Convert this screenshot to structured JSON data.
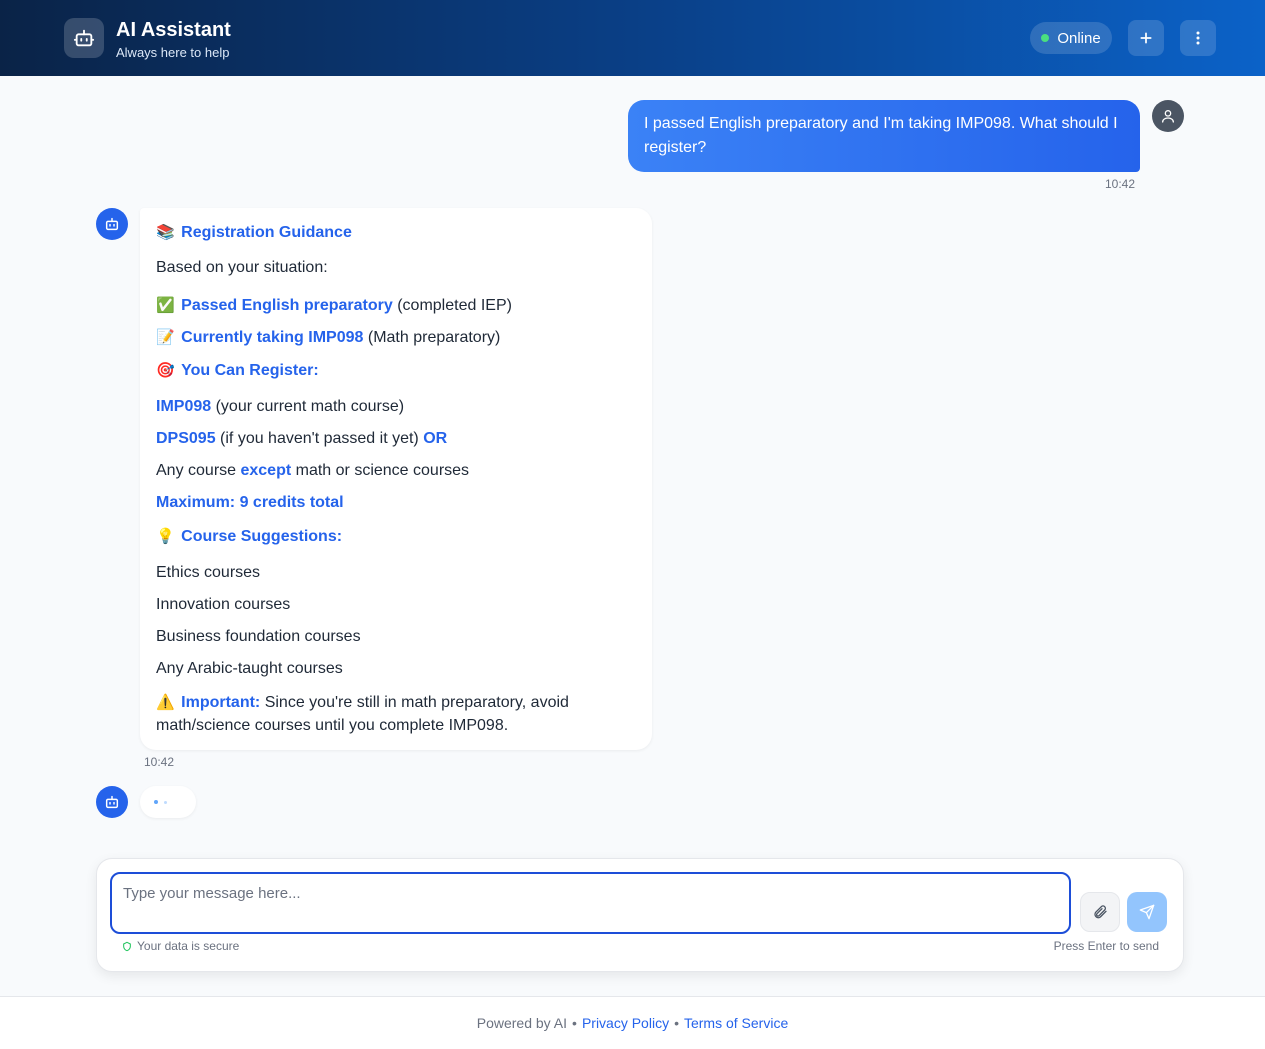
{
  "header": {
    "title": "AI Assistant",
    "subtitle": "Always here to help",
    "status": "Online",
    "new_chat_icon": "plus-icon",
    "menu_icon": "more-vertical-icon"
  },
  "conversation": {
    "user_message": {
      "text": "I passed English preparatory and I'm taking IMP098. What should I register?",
      "time": "10:42"
    },
    "bot_message": {
      "time": "10:42",
      "heading_emoji": "📚",
      "heading": "Registration Guidance",
      "intro": "Based on your situation:",
      "status_1_emoji": "✅",
      "status_1_bold": "Passed English preparatory",
      "status_1_rest": " (completed IEP)",
      "status_2_emoji": "📝",
      "status_2_bold": "Currently taking IMP098",
      "status_2_rest": " (Math preparatory)",
      "register_emoji": "🎯",
      "register_heading": "You Can Register:",
      "option_1_bold": "IMP098",
      "option_1_rest": " (your current math course)",
      "option_2_bold": "DPS095",
      "option_2_rest": " (if you haven't passed it yet) ",
      "option_2_or": "OR",
      "option_3_pre": "Any course ",
      "option_3_bold": "except",
      "option_3_rest": " math or science courses",
      "max_credits": "Maximum: 9 credits total",
      "suggest_emoji": "💡",
      "suggest_heading": "Course Suggestions:",
      "suggestions": [
        "Ethics courses",
        "Innovation courses",
        "Business foundation courses",
        "Any Arabic-taught courses"
      ],
      "warn_emoji": "⚠️",
      "warn_bold": "Important:",
      "warn_line1": " Since you're still in math preparatory, avoid",
      "warn_line2": "math/science courses until you complete IMP098."
    }
  },
  "composer": {
    "placeholder": "Type your message here...",
    "secure_text": "Your data is secure",
    "hint": "Press Enter to send"
  },
  "footer": {
    "powered": "Powered by AI",
    "sep": "•",
    "privacy": "Privacy Policy",
    "terms": "Terms of Service"
  },
  "colors": {
    "accent": "#2563eb",
    "header_start": "#0a2347",
    "header_end": "#0b62c8",
    "online": "#4ade80"
  }
}
